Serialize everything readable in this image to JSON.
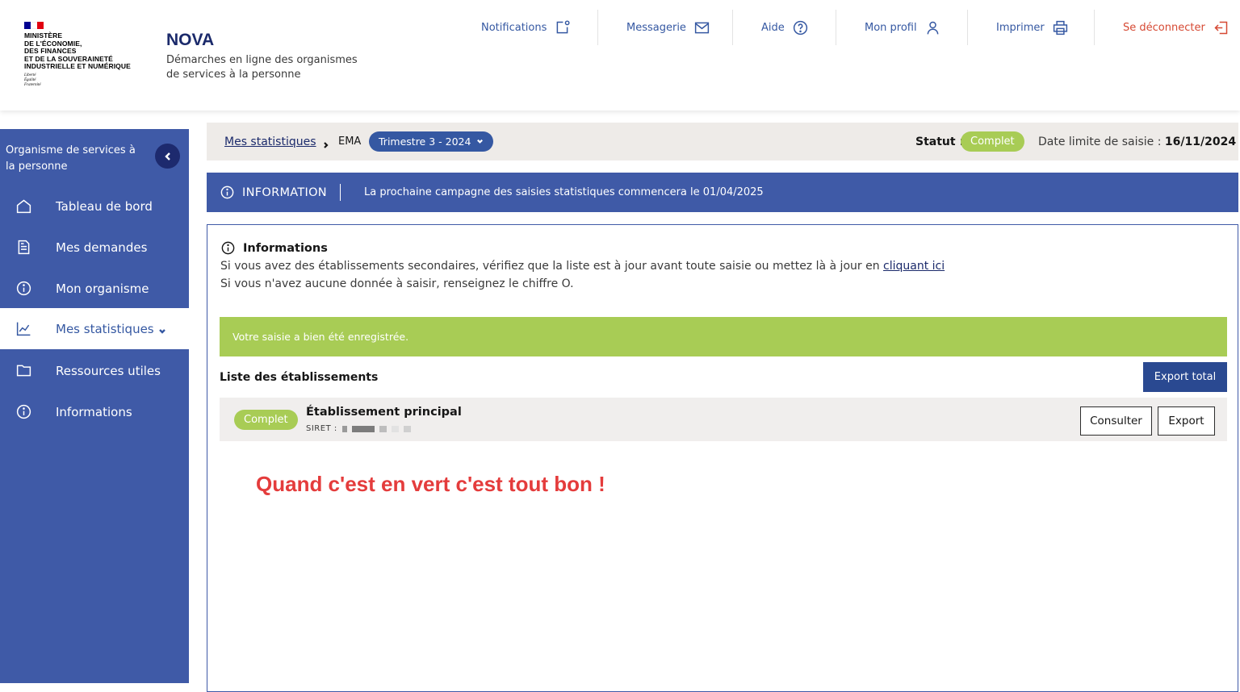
{
  "header": {
    "ministry_lines": [
      "Ministère",
      "de l'Économie,",
      "des Finances",
      "et de la Souveraineté",
      "industrielle et numérique"
    ],
    "motto_lines": [
      "Liberté",
      "Égalité",
      "Fraternité"
    ],
    "app_name": "NOVA",
    "app_desc": "Démarches en ligne des organismes de services à la personne",
    "nav": {
      "notifications": "Notifications",
      "messagerie": "Messagerie",
      "aide": "Aide",
      "profil": "Mon profil",
      "imprimer": "Imprimer",
      "logout": "Se déconnecter"
    }
  },
  "sidebar": {
    "title": "Organisme de services à la personne",
    "items": [
      {
        "label": "Tableau de bord",
        "icon": "home-icon"
      },
      {
        "label": "Mes demandes",
        "icon": "document-icon"
      },
      {
        "label": "Mon organisme",
        "icon": "info-icon"
      },
      {
        "label": "Mes statistiques",
        "icon": "chart-icon"
      },
      {
        "label": "Ressources utiles",
        "icon": "folder-icon"
      },
      {
        "label": "Informations",
        "icon": "info-icon"
      }
    ]
  },
  "breadcrumb": {
    "link": "Mes statistiques",
    "current": "EMA",
    "period": "Trimestre 3 - 2024",
    "status_label": "Statut :",
    "status_value": "Complet",
    "deadline_label": "Date limite de saisie :",
    "deadline_value": "16/11/2024"
  },
  "banner": {
    "title": "INFORMATION",
    "message": "La prochaine campagne des saisies statistiques commencera le 01/04/2025"
  },
  "informations": {
    "title": "Informations",
    "line1": "Si vous avez des établissements secondaires, vérifiez que la liste est à jour avant toute saisie ou mettez là à jour en",
    "line1_link": "cliquant ici",
    "line2": "Si vous n'avez aucune donnée à saisir, renseignez le chiffre O."
  },
  "success_message": "Votre saisie a bien été enregistrée.",
  "list": {
    "title": "Liste des établissements",
    "export_total": "Export total",
    "rows": [
      {
        "status": "Complet",
        "name": "Établissement principal",
        "siret_label": "SIRET :",
        "consult": "Consulter",
        "export": "Export"
      }
    ]
  },
  "annotation": "Quand c'est en vert c'est tout bon !",
  "colors": {
    "primary": "#3f5aa7",
    "dark_navy": "#1b2a6b",
    "success": "#a8cc55",
    "danger": "#d64933",
    "annotation": "#e43c3c"
  }
}
